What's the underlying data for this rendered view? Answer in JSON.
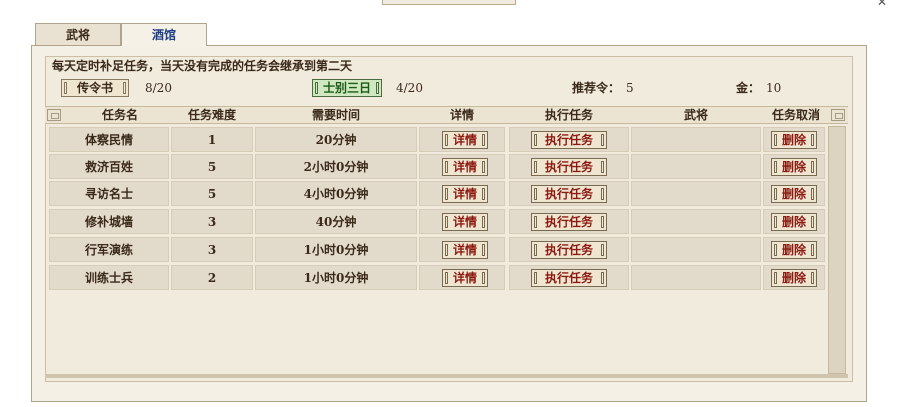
{
  "tabs": [
    {
      "label": "武将"
    },
    {
      "label": "酒馆"
    }
  ],
  "notice": "每天定时补足任务，当天没有完成的任务会继承到第二天",
  "orders": {
    "book_label": "传令书",
    "book_count": "8/20",
    "special_label": "士别三日",
    "special_count": "4/20",
    "recommend_label": "推荐令：",
    "recommend_value": "5",
    "gold_label": "金：",
    "gold_value": "10"
  },
  "table": {
    "headers": [
      "任务名",
      "任务难度",
      "需要时间",
      "详情",
      "执行任务",
      "武将",
      "任务取消"
    ],
    "rows": [
      {
        "name": "体察民情",
        "difficulty": "1",
        "time": "20分钟",
        "detail": "详情",
        "execute": "执行任务",
        "general": "",
        "cancel": "删除"
      },
      {
        "name": "救济百姓",
        "difficulty": "5",
        "time": "2小时0分钟",
        "detail": "详情",
        "execute": "执行任务",
        "general": "",
        "cancel": "删除"
      },
      {
        "name": "寻访名士",
        "difficulty": "5",
        "time": "4小时0分钟",
        "detail": "详情",
        "execute": "执行任务",
        "general": "",
        "cancel": "删除"
      },
      {
        "name": "修补城墙",
        "difficulty": "3",
        "time": "40分钟",
        "detail": "详情",
        "execute": "执行任务",
        "general": "",
        "cancel": "删除"
      },
      {
        "name": "行军演练",
        "difficulty": "3",
        "time": "1小时0分钟",
        "detail": "详情",
        "execute": "执行任务",
        "general": "",
        "cancel": "删除"
      },
      {
        "name": "训练士兵",
        "difficulty": "2",
        "time": "1小时0分钟",
        "detail": "详情",
        "execute": "执行任务",
        "general": "",
        "cancel": "删除"
      }
    ]
  },
  "icons": {
    "close": "close-icon",
    "corner": "corner-ornament-icon"
  }
}
